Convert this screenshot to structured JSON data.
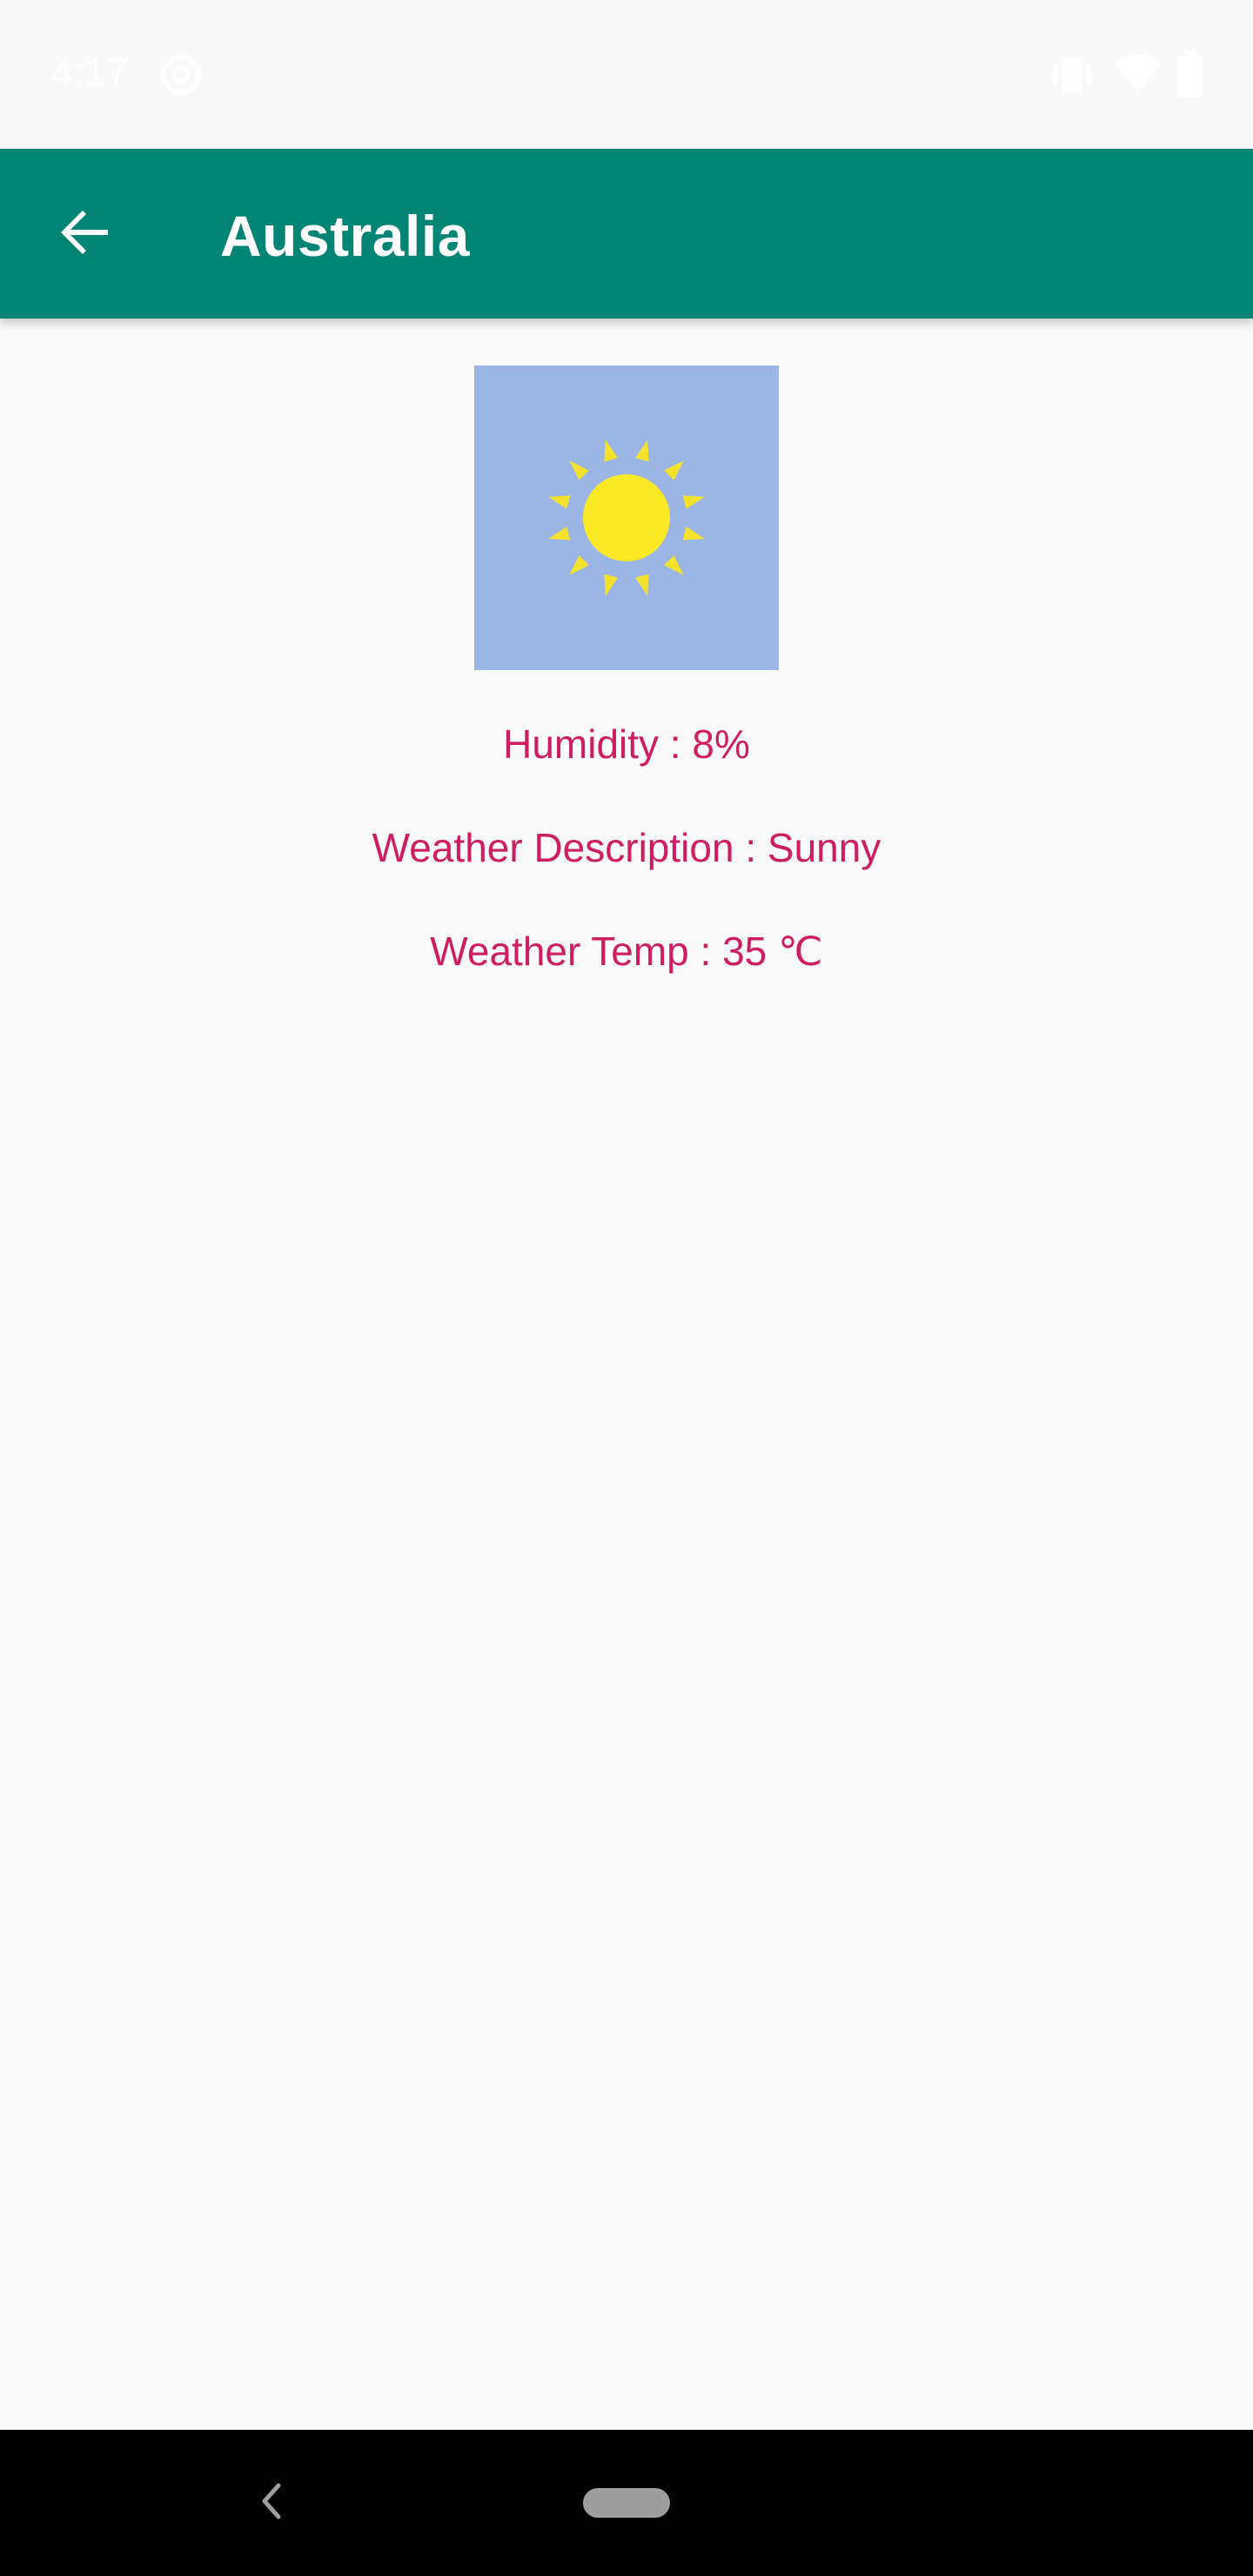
{
  "status_bar": {
    "time": "4:17",
    "icons": [
      "notification-sync-icon",
      "vibrate-icon",
      "wifi-icon",
      "battery-icon"
    ]
  },
  "app_bar": {
    "title": "Australia",
    "back_icon": "arrow-back-icon",
    "background_color": "#038575"
  },
  "weather": {
    "image_icon": "sun-icon",
    "image_background": "#9bb6e5",
    "humidity": "Humidity : 8%",
    "description": "Weather Description : Sunny",
    "temperature": "Weather Temp : 35 ℃",
    "text_color": "#cf1d62"
  },
  "nav_bar": {
    "back_icon": "chevron-left-icon",
    "home_icon": "home-pill-icon"
  }
}
